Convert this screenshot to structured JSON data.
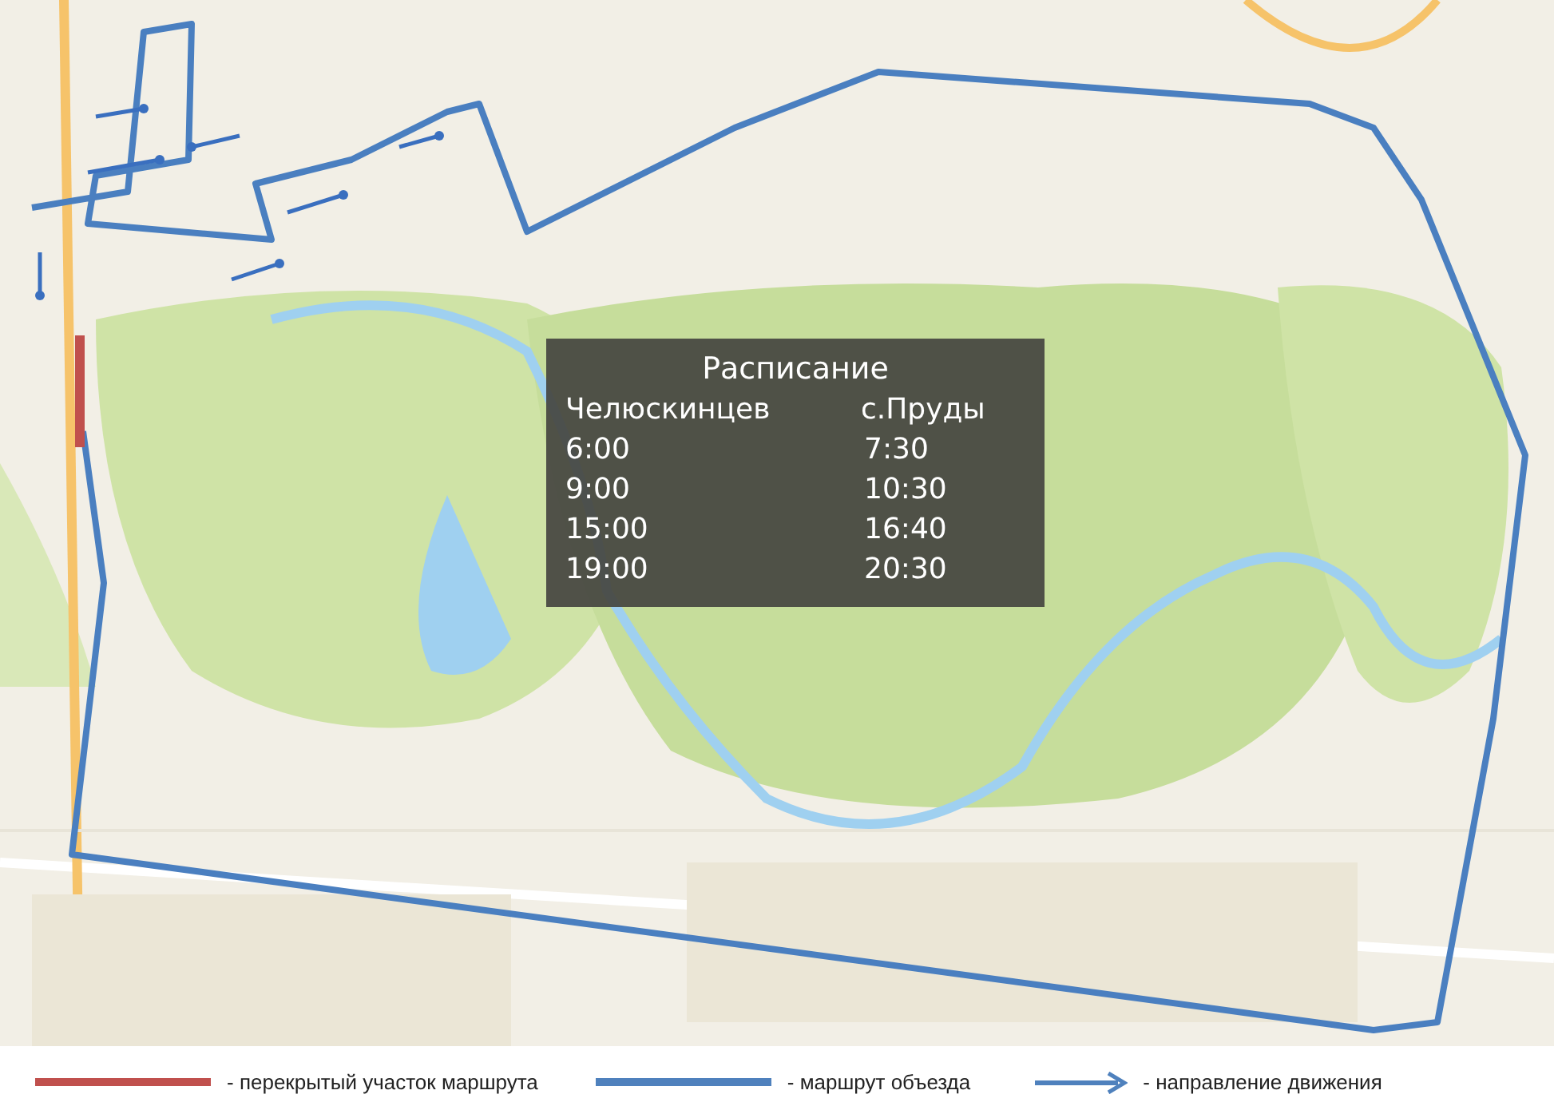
{
  "schedule": {
    "title": "Расписание",
    "columns": [
      "Челюскинцев",
      "с.Пруды"
    ],
    "rows": [
      [
        "6:00",
        "7:30"
      ],
      [
        "9:00",
        "10:30"
      ],
      [
        "15:00",
        "16:40"
      ],
      [
        "19:00",
        "20:30"
      ]
    ]
  },
  "legend": [
    {
      "kind": "line",
      "color": "#c0504d",
      "label": "- перекрытый участок маршрута"
    },
    {
      "kind": "line",
      "color": "#4f81bd",
      "label": "- маршрут  объезда"
    },
    {
      "kind": "arrow",
      "color": "#4f81bd",
      "label": "- направление движения"
    }
  ]
}
